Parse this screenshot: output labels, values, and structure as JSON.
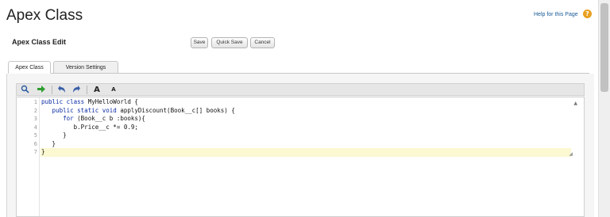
{
  "page": {
    "title": "Apex Class",
    "help_text": "Help for this Page",
    "help_icon": "question-icon"
  },
  "edit_section": {
    "title": "Apex Class Edit"
  },
  "buttons": {
    "save": "Save",
    "quick_save": "Quick Save",
    "cancel": "Cancel"
  },
  "tabs": [
    {
      "label": "Apex Class",
      "active": true
    },
    {
      "label": "Version Settings",
      "active": false
    }
  ],
  "toolbar": {
    "icons": [
      "search-icon",
      "go-to-line-arrow-icon",
      "undo-icon",
      "redo-icon",
      "increase-font-icon",
      "decrease-font-icon"
    ],
    "font_large": "A",
    "font_small": "A"
  },
  "editor": {
    "line_numbers": [
      "1",
      "2",
      "3",
      "4",
      "5",
      "6",
      "7"
    ],
    "active_line": "7",
    "lines": [
      "public class MyHelloWorld {",
      "   public static void applyDiscount(Book__c[] books) {",
      "      for (Book__c b :books){",
      "         b.Price__c *= 0.9;",
      "      }",
      "   }",
      "}"
    ]
  },
  "colors": {
    "keyword": "#0a2aa3",
    "link": "#1a5a96",
    "help_icon": "#e8a020",
    "active_line": "#fbf8d2",
    "go_arrow": "#2e9e2e",
    "undo_redo": "#3a5fa8"
  }
}
